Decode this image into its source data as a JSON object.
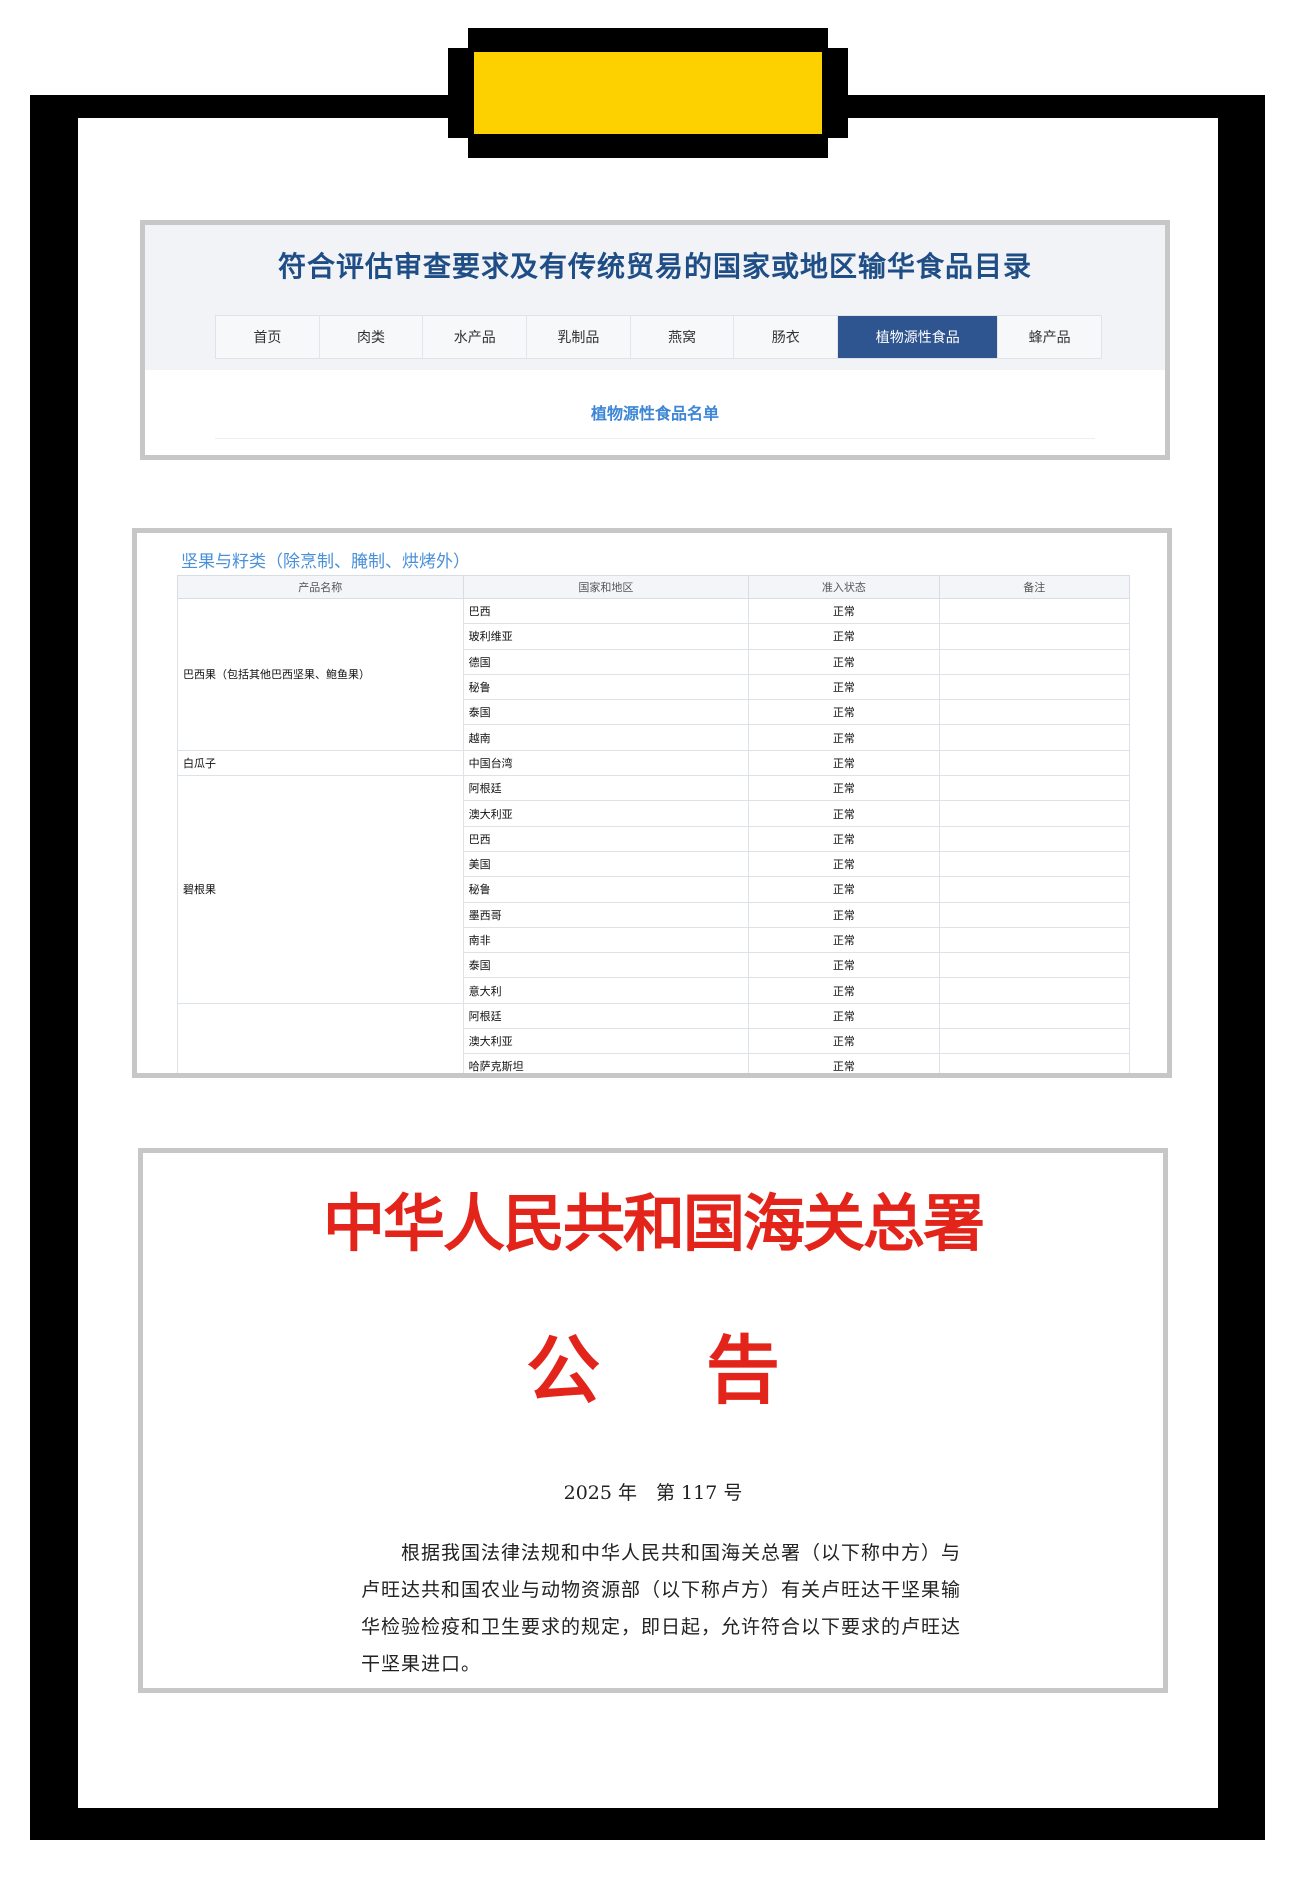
{
  "site": {
    "title": "符合评估审查要求及有传统贸易的国家或地区输华食品目录",
    "nav": [
      "首页",
      "肉类",
      "水产品",
      "乳制品",
      "燕窝",
      "肠衣",
      "植物源性食品",
      "蜂产品"
    ],
    "active_nav": "植物源性食品",
    "list_title": "植物源性食品名单"
  },
  "table": {
    "category_title": "坚果与籽类（除烹制、腌制、烘烤外）",
    "headers": [
      "产品名称",
      "国家和地区",
      "准入状态",
      "备注"
    ],
    "groups": [
      {
        "product": "巴西果（包括其他巴西坚果、鲍鱼果）",
        "countries": [
          "巴西",
          "玻利维亚",
          "德国",
          "秘鲁",
          "泰国",
          "越南"
        ]
      },
      {
        "product": "白瓜子",
        "countries": [
          "中国台湾"
        ]
      },
      {
        "product": "碧根果",
        "countries": [
          "阿根廷",
          "澳大利亚",
          "巴西",
          "美国",
          "秘鲁",
          "墨西哥",
          "南非",
          "泰国",
          "意大利"
        ]
      },
      {
        "product": "",
        "countries": [
          "阿根廷",
          "澳大利亚",
          "哈萨克斯坦"
        ]
      }
    ],
    "status": "正常"
  },
  "notice": {
    "agency": "中华人民共和国海关总署",
    "heading": "公 告",
    "number": "2025 年　第 117 号",
    "body": "根据我国法律法规和中华人民共和国海关总署（以下称中方）与卢旺达共和国农业与动物资源部（以下称卢方）有关卢旺达干坚果输华检验检疫和卫生要求的规定，即日起，允许符合以下要求的卢旺达干坚果进口。"
  },
  "colors": {
    "clip_yellow": "#fdd000",
    "nav_active": "#2f5590",
    "site_title": "#1f4e86",
    "gov_red": "#e3241b",
    "link_blue": "#3d86d6"
  }
}
